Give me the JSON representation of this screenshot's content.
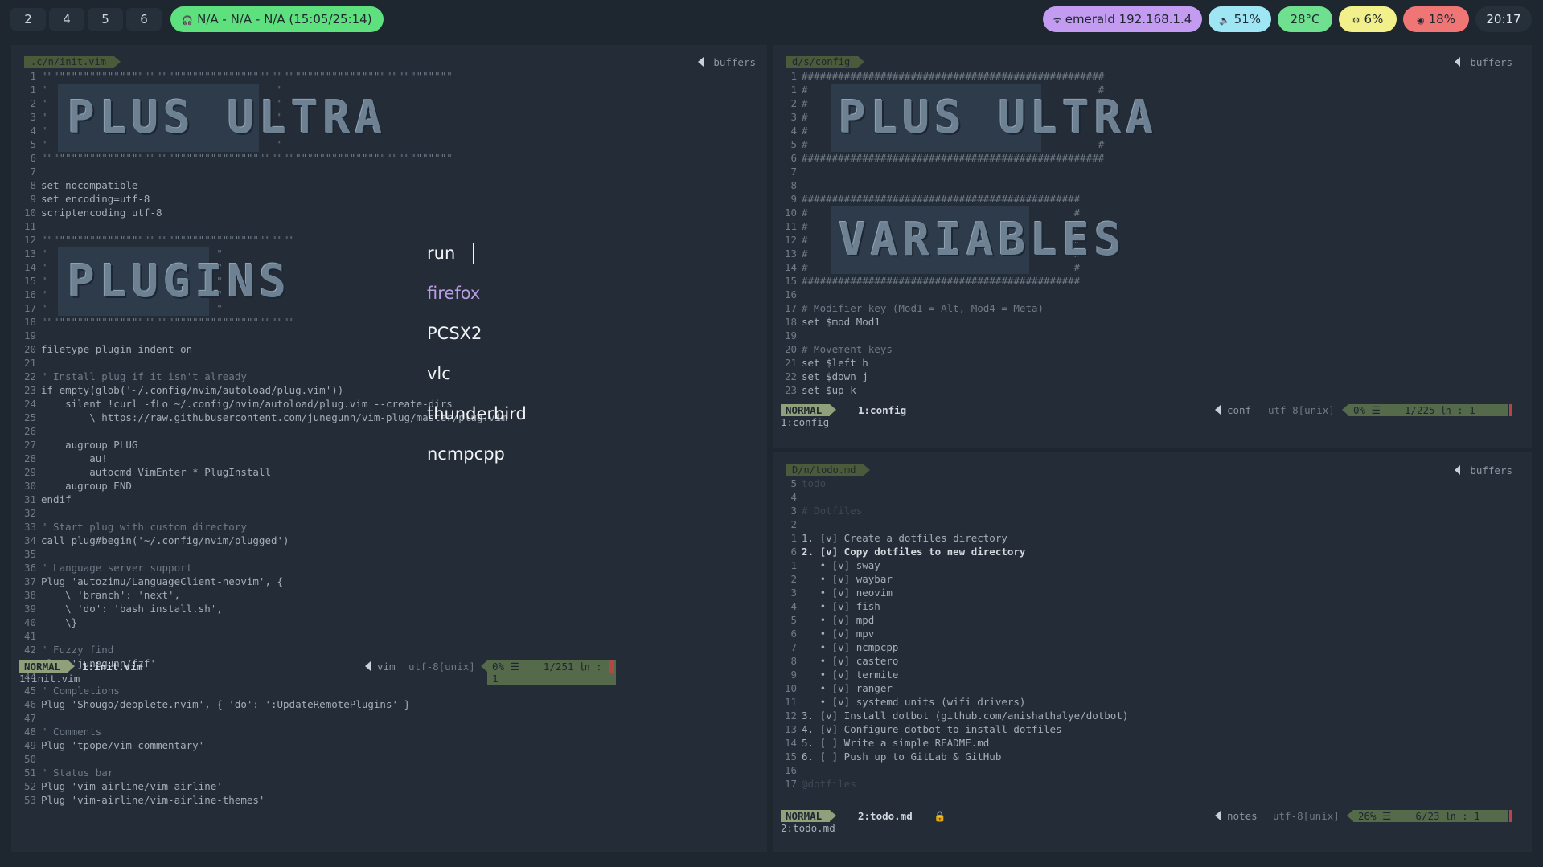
{
  "topbar": {
    "workspaces": [
      "2",
      "4",
      "5",
      "6"
    ],
    "media": "N/A - N/A - N/A (15:05/25:14)",
    "network": "emerald 192.168.1.4",
    "volume": "51%",
    "temperature": "28°C",
    "cpu": "6%",
    "memory": "18%",
    "clock": "20:17",
    "colors": {
      "media": "#5ee07e",
      "network": "#c39bf0",
      "volume": "#9fe6f4",
      "temperature": "#6fe08f",
      "cpu": "#f2f08a",
      "memory": "#f07676"
    }
  },
  "launcher": {
    "prompt": "run",
    "items": [
      "firefox",
      "PCSX2",
      "vlc",
      "thunderbird",
      "ncmpcpp"
    ],
    "selected_color": "#b79be3"
  },
  "left_pane": {
    "filename": ".c/n/init.vim",
    "buffers_label": "buffers",
    "banners": [
      "PLUS ULTRA",
      "PLUGINS"
    ],
    "status": {
      "mode": "NORMAL",
      "buffer": "1:init.vim",
      "filetype": "vim",
      "encoding": "utf-8[unix]",
      "percent": "0% ☰",
      "position": "1/251 ㏑ :  1"
    },
    "cmdline": "1:init.vim"
  },
  "top_right_pane": {
    "filename": "d/s/config",
    "buffers_label": "buffers",
    "banners": [
      "PLUS ULTRA",
      "VARIABLES"
    ],
    "status": {
      "mode": "NORMAL",
      "buffer": "1:config",
      "filetype": "conf",
      "encoding": "utf-8[unix]",
      "percent": "0% ☰",
      "position": "1/225 ㏑ :  1"
    },
    "cmdline": "1:config"
  },
  "bottom_right_pane": {
    "filename": "D/n/todo.md",
    "buffers_label": "buffers",
    "status": {
      "mode": "NORMAL",
      "buffer": "2:todo.md",
      "filetype": "notes",
      "encoding": "utf-8[unix]",
      "percent": "26% ☰",
      "position": "6/23 ㏑ :  1"
    },
    "cmdline": "2:todo.md",
    "lines": [
      {
        "n": "5",
        "t": "todo",
        "c": "dim"
      },
      {
        "n": "4",
        "t": "",
        "c": ""
      },
      {
        "n": "3",
        "t": "# Dotfiles",
        "c": "dim"
      },
      {
        "n": "2",
        "t": "",
        "c": ""
      },
      {
        "n": "1",
        "t": "1. [v] Create a dotfiles directory",
        "c": ""
      },
      {
        "n": "6",
        "t": "2. [v] Copy dotfiles to new directory",
        "c": "bold"
      },
      {
        "n": "1",
        "t": "   • [v] sway",
        "c": ""
      },
      {
        "n": "2",
        "t": "   • [v] waybar",
        "c": ""
      },
      {
        "n": "3",
        "t": "   • [v] neovim",
        "c": ""
      },
      {
        "n": "4",
        "t": "   • [v] fish",
        "c": ""
      },
      {
        "n": "5",
        "t": "   • [v] mpd",
        "c": ""
      },
      {
        "n": "6",
        "t": "   • [v] mpv",
        "c": ""
      },
      {
        "n": "7",
        "t": "   • [v] ncmpcpp",
        "c": ""
      },
      {
        "n": "8",
        "t": "   • [v] castero",
        "c": ""
      },
      {
        "n": "9",
        "t": "   • [v] termite",
        "c": ""
      },
      {
        "n": "10",
        "t": "   • [v] ranger",
        "c": ""
      },
      {
        "n": "11",
        "t": "   • [v] systemd units (wifi drivers)",
        "c": ""
      },
      {
        "n": "12",
        "t": "3. [v] Install dotbot (github.com/anishathalye/dotbot)",
        "c": ""
      },
      {
        "n": "13",
        "t": "4. [v] Configure dotbot to install dotfiles",
        "c": ""
      },
      {
        "n": "14",
        "t": "5. [ ] Write a simple README.md",
        "c": ""
      },
      {
        "n": "15",
        "t": "6. [ ] Push up to GitLab & GitHub",
        "c": ""
      },
      {
        "n": "16",
        "t": "",
        "c": ""
      },
      {
        "n": "17",
        "t": "@dotfiles",
        "c": "dim"
      }
    ]
  },
  "left_lines": [
    {
      "n": "1",
      "t": "\"\"\"\"\"\"\"\"\"\"\"\"\"\"\"\"\"\"\"\"\"\"\"\"\"\"\"\"\"\"\"\"\"\"\"\"\"\"\"\"\"\"\"\"\"\"\"\"\"\"\"\"\"\"\"\"\"\"\"\"\"\"\"\"\"\"\"\"",
      "c": "cm"
    },
    {
      "n": "1",
      "t": "\"                                      \"",
      "c": "cm"
    },
    {
      "n": "2",
      "t": "\"                                      \"",
      "c": "cm"
    },
    {
      "n": "3",
      "t": "\"                                      \"",
      "c": "cm"
    },
    {
      "n": "4",
      "t": "\"                                      \"",
      "c": "cm"
    },
    {
      "n": "5",
      "t": "\"                                      \"",
      "c": "cm"
    },
    {
      "n": "6",
      "t": "\"\"\"\"\"\"\"\"\"\"\"\"\"\"\"\"\"\"\"\"\"\"\"\"\"\"\"\"\"\"\"\"\"\"\"\"\"\"\"\"\"\"\"\"\"\"\"\"\"\"\"\"\"\"\"\"\"\"\"\"\"\"\"\"\"\"\"\"",
      "c": "cm"
    },
    {
      "n": "7",
      "t": "",
      "c": ""
    },
    {
      "n": "8",
      "t": "set nocompatible",
      "c": ""
    },
    {
      "n": "9",
      "t": "set encoding=utf-8",
      "c": ""
    },
    {
      "n": "10",
      "t": "scriptencoding utf-8",
      "c": ""
    },
    {
      "n": "11",
      "t": "",
      "c": ""
    },
    {
      "n": "12",
      "t": "\"\"\"\"\"\"\"\"\"\"\"\"\"\"\"\"\"\"\"\"\"\"\"\"\"\"\"\"\"\"\"\"\"\"\"\"\"\"\"\"\"\"",
      "c": "cm"
    },
    {
      "n": "13",
      "t": "\"                            \"",
      "c": "cm"
    },
    {
      "n": "14",
      "t": "\"                            \"",
      "c": "cm"
    },
    {
      "n": "15",
      "t": "\"                            \"",
      "c": "cm"
    },
    {
      "n": "16",
      "t": "\"                            \"",
      "c": "cm"
    },
    {
      "n": "17",
      "t": "\"                            \"",
      "c": "cm"
    },
    {
      "n": "18",
      "t": "\"\"\"\"\"\"\"\"\"\"\"\"\"\"\"\"\"\"\"\"\"\"\"\"\"\"\"\"\"\"\"\"\"\"\"\"\"\"\"\"\"\"",
      "c": "cm"
    },
    {
      "n": "19",
      "t": "",
      "c": ""
    },
    {
      "n": "20",
      "t": "filetype plugin indent on",
      "c": ""
    },
    {
      "n": "21",
      "t": "",
      "c": ""
    },
    {
      "n": "22",
      "t": "\" Install plug if it isn't already",
      "c": "cm"
    },
    {
      "n": "23",
      "t": "if empty(glob('~/.config/nvim/autoload/plug.vim'))",
      "c": ""
    },
    {
      "n": "24",
      "t": "    silent !curl -fLo ~/.config/nvim/autoload/plug.vim --create-dirs",
      "c": ""
    },
    {
      "n": "25",
      "t": "        \\ https://raw.githubusercontent.com/junegunn/vim-plug/master/plug.vim",
      "c": ""
    },
    {
      "n": "26",
      "t": "",
      "c": ""
    },
    {
      "n": "27",
      "t": "    augroup PLUG",
      "c": ""
    },
    {
      "n": "28",
      "t": "        au!",
      "c": ""
    },
    {
      "n": "29",
      "t": "        autocmd VimEnter * PlugInstall",
      "c": ""
    },
    {
      "n": "30",
      "t": "    augroup END",
      "c": ""
    },
    {
      "n": "31",
      "t": "endif",
      "c": ""
    },
    {
      "n": "32",
      "t": "",
      "c": ""
    },
    {
      "n": "33",
      "t": "\" Start plug with custom directory",
      "c": "cm"
    },
    {
      "n": "34",
      "t": "call plug#begin('~/.config/nvim/plugged')",
      "c": ""
    },
    {
      "n": "35",
      "t": "",
      "c": ""
    },
    {
      "n": "36",
      "t": "\" Language server support",
      "c": "cm"
    },
    {
      "n": "37",
      "t": "Plug 'autozimu/LanguageClient-neovim', {",
      "c": ""
    },
    {
      "n": "38",
      "t": "    \\ 'branch': 'next',",
      "c": ""
    },
    {
      "n": "39",
      "t": "    \\ 'do': 'bash install.sh',",
      "c": ""
    },
    {
      "n": "40",
      "t": "    \\}",
      "c": ""
    },
    {
      "n": "41",
      "t": "",
      "c": ""
    },
    {
      "n": "42",
      "t": "\" Fuzzy find",
      "c": "cm"
    },
    {
      "n": "43",
      "t": "Plug 'junegunn/fzf'",
      "c": ""
    },
    {
      "n": "44",
      "t": "",
      "c": ""
    },
    {
      "n": "45",
      "t": "\" Completions",
      "c": "cm"
    },
    {
      "n": "46",
      "t": "Plug 'Shougo/deoplete.nvim', { 'do': ':UpdateRemotePlugins' }",
      "c": ""
    },
    {
      "n": "47",
      "t": "",
      "c": ""
    },
    {
      "n": "48",
      "t": "\" Comments",
      "c": "cm"
    },
    {
      "n": "49",
      "t": "Plug 'tpope/vim-commentary'",
      "c": ""
    },
    {
      "n": "50",
      "t": "",
      "c": ""
    },
    {
      "n": "51",
      "t": "\" Status bar",
      "c": "cm"
    },
    {
      "n": "52",
      "t": "Plug 'vim-airline/vim-airline'",
      "c": ""
    },
    {
      "n": "53",
      "t": "Plug 'vim-airline/vim-airline-themes'",
      "c": ""
    }
  ],
  "tr_lines": [
    {
      "n": "1",
      "t": "##################################################",
      "c": "cm"
    },
    {
      "n": "1",
      "t": "#                                                #",
      "c": "cm"
    },
    {
      "n": "2",
      "t": "#                                                #",
      "c": "cm"
    },
    {
      "n": "3",
      "t": "#                                                #",
      "c": "cm"
    },
    {
      "n": "4",
      "t": "#                                                #",
      "c": "cm"
    },
    {
      "n": "5",
      "t": "#                                                #",
      "c": "cm"
    },
    {
      "n": "6",
      "t": "##################################################",
      "c": "cm"
    },
    {
      "n": "7",
      "t": "",
      "c": ""
    },
    {
      "n": "8",
      "t": "",
      "c": ""
    },
    {
      "n": "9",
      "t": "##############################################",
      "c": "cm"
    },
    {
      "n": "10",
      "t": "#                                            #",
      "c": "cm"
    },
    {
      "n": "11",
      "t": "#                                            #",
      "c": "cm"
    },
    {
      "n": "12",
      "t": "#                                            #",
      "c": "cm"
    },
    {
      "n": "13",
      "t": "#                                            #",
      "c": "cm"
    },
    {
      "n": "14",
      "t": "#                                            #",
      "c": "cm"
    },
    {
      "n": "15",
      "t": "##############################################",
      "c": "cm"
    },
    {
      "n": "16",
      "t": "",
      "c": ""
    },
    {
      "n": "17",
      "t": "# Modifier key (Mod1 = Alt, Mod4 = Meta)",
      "c": "cm"
    },
    {
      "n": "18",
      "t": "set $mod Mod1",
      "c": ""
    },
    {
      "n": "19",
      "t": "",
      "c": ""
    },
    {
      "n": "20",
      "t": "# Movement keys",
      "c": "cm"
    },
    {
      "n": "21",
      "t": "set $left h",
      "c": ""
    },
    {
      "n": "22",
      "t": "set $down j",
      "c": ""
    },
    {
      "n": "23",
      "t": "set $up k",
      "c": ""
    }
  ]
}
